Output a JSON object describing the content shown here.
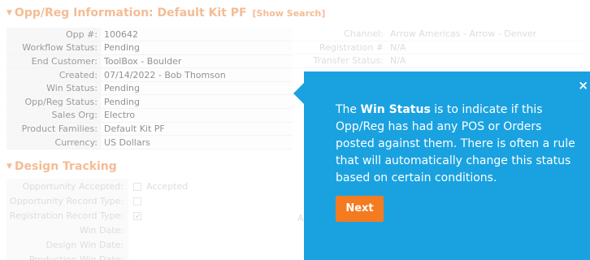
{
  "section": {
    "title": "Opp/Reg Information: Default Kit PF",
    "show_search": "[Show Search]"
  },
  "info_rows": [
    {
      "label": "Opp #:",
      "value": "100642"
    },
    {
      "label": "Workflow Status:",
      "value": "Pending"
    },
    {
      "label": "End Customer:",
      "value": "ToolBox - Boulder"
    },
    {
      "label": "Created:",
      "value": "07/14/2022 - Bob Thomson"
    },
    {
      "label": "Win Status:",
      "value": "Pending"
    },
    {
      "label": "Opp/Reg Status:",
      "value": "Pending"
    },
    {
      "label": "Sales Org:",
      "value": "Electro"
    },
    {
      "label": "Product Families:",
      "value": "Default Kit PF"
    },
    {
      "label": "Currency:",
      "value": "US Dollars"
    }
  ],
  "right_rows": [
    {
      "label": "Channel:",
      "value": "Arrow Americas - Arrow - Denver"
    },
    {
      "label": "Registration #",
      "value": "N/A"
    },
    {
      "label": "Transfer Status:",
      "value": "N/A"
    }
  ],
  "design_tracking": {
    "title": "Design Tracking",
    "rows": [
      {
        "label": "Opportunity Accepted:",
        "value": "Accepted"
      },
      {
        "label": "Opportunity Record Type:",
        "value": ""
      },
      {
        "label": "Registration Record Type:",
        "value": ""
      },
      {
        "label": "Win Date:",
        "value": ""
      },
      {
        "label": "Design Win Date:",
        "value": ""
      },
      {
        "label": "Production Win Date:",
        "value": ""
      }
    ],
    "side_label": "A"
  },
  "tooltip": {
    "text_pre": "The ",
    "text_bold": "Win Status",
    "text_post": " is to indicate if this Opp/Reg has had any POS or Orders posted against them. There is often a rule that will automatically change this status based on certain conditions.",
    "next_label": "Next",
    "close_label": "×"
  },
  "colors": {
    "accent_orange": "#e8792a",
    "tooltip_blue": "#1aa2e0",
    "next_button": "#f47b20"
  }
}
